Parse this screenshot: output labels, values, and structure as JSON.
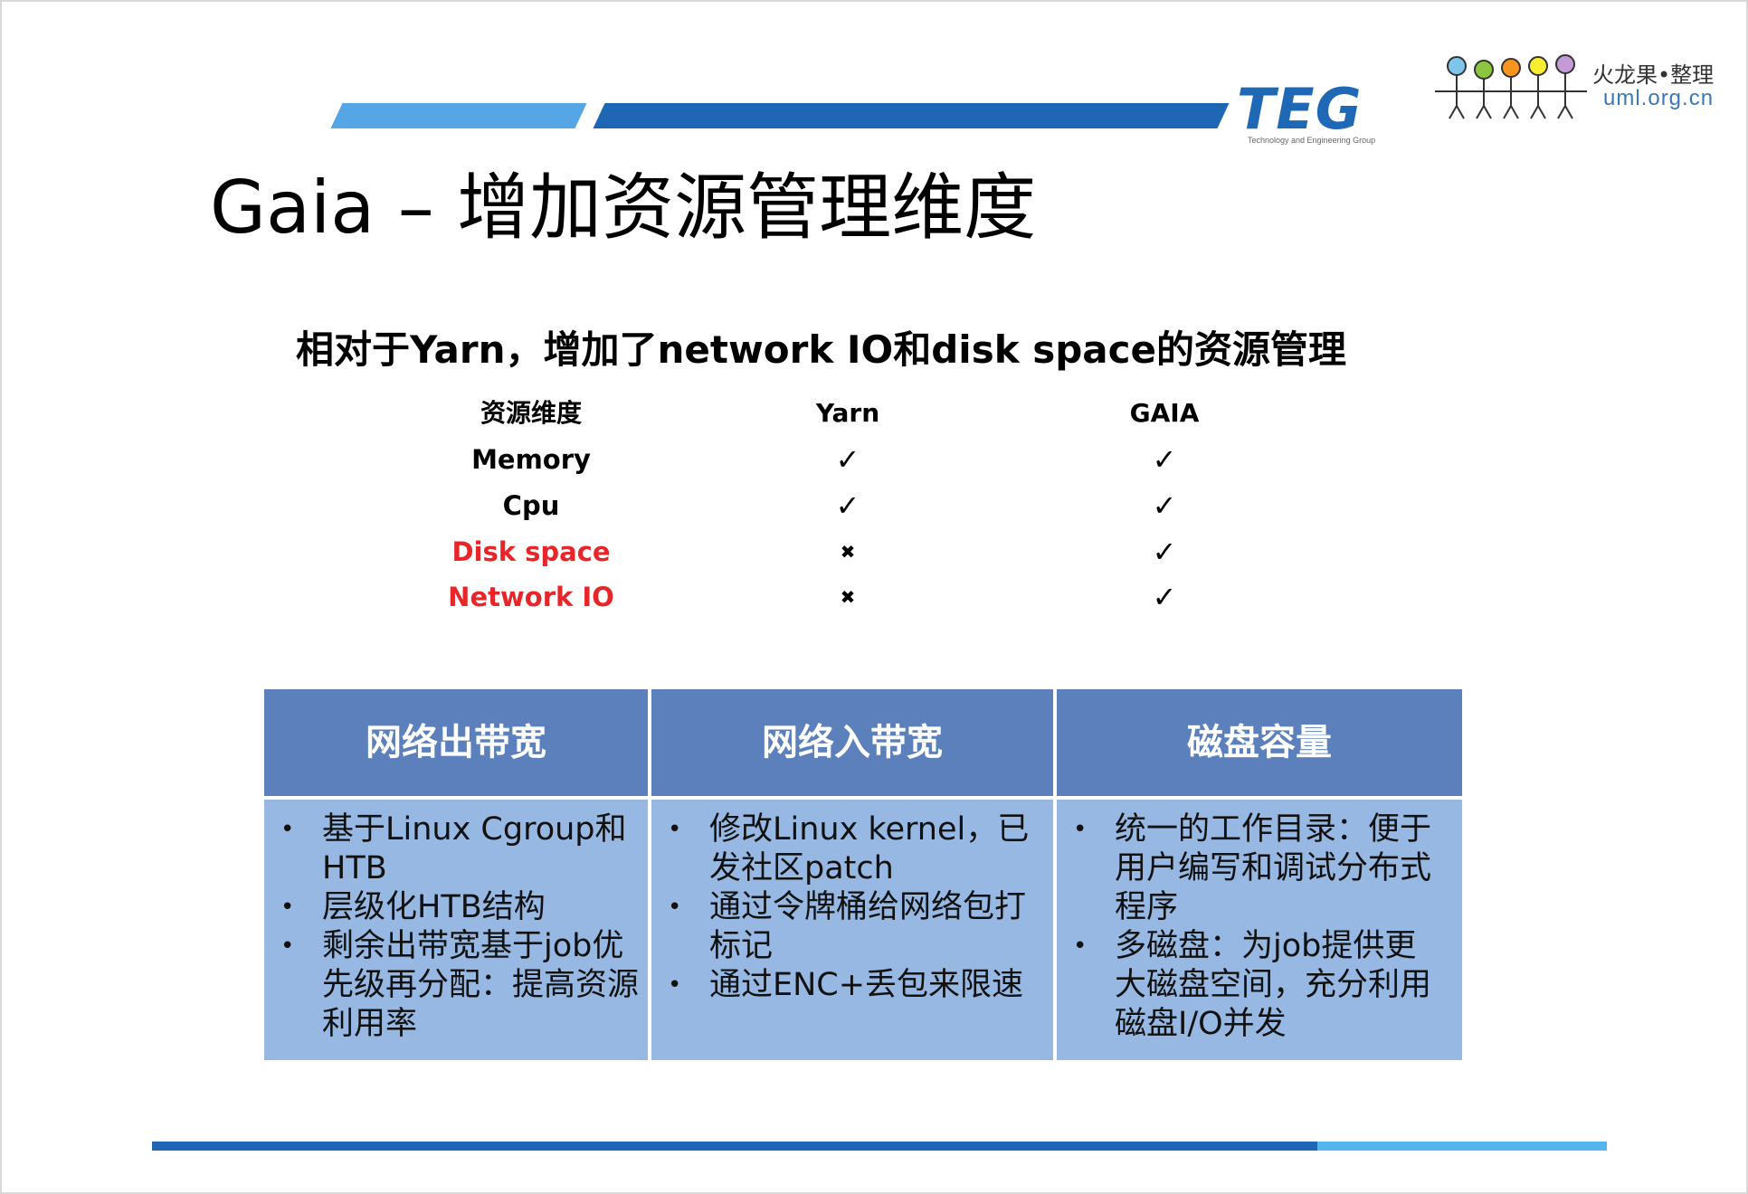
{
  "header": {
    "teg_logo_text": "TEG",
    "teg_logo_subtext": "Technology and Engineering Group",
    "watermark_top": "火龙果•整理",
    "watermark_bottom": "uml.org.cn"
  },
  "title": "Gaia – 增加资源管理维度",
  "subtitle": "相对于Yarn，增加了network IO和disk space的资源管理",
  "comparison": {
    "headers": [
      "资源维度",
      "Yarn",
      "GAIA"
    ],
    "rows": [
      {
        "name": "Memory",
        "yarn": "✓",
        "gaia": "✓",
        "highlight": false
      },
      {
        "name": "Cpu",
        "yarn": "✓",
        "gaia": "✓",
        "highlight": false
      },
      {
        "name": "Disk space",
        "yarn": "✖",
        "gaia": "✓",
        "highlight": true
      },
      {
        "name": "Network IO",
        "yarn": "✖",
        "gaia": "✓",
        "highlight": true
      }
    ],
    "highlight_color": "#e8262a"
  },
  "features": {
    "columns": [
      {
        "title": "网络出带宽",
        "items": [
          [
            "基于Linux Cgroup和",
            "HTB"
          ],
          [
            "层级化HTB结构"
          ],
          [
            "剩余出带宽基于job优",
            "先级再分配：提高资源",
            "利用率"
          ]
        ]
      },
      {
        "title": "网络入带宽",
        "items": [
          [
            "修改Linux kernel，已",
            "发社区patch"
          ],
          [
            "通过令牌桶给网络包打",
            "标记"
          ],
          [
            "通过ENC+丢包来限速"
          ]
        ]
      },
      {
        "title": "磁盘容量",
        "items": [
          [
            "统一的工作目录：便于",
            "用户编写和调试分布式",
            "程序"
          ],
          [
            "多磁盘：为job提供更",
            "大磁盘空间，充分利用",
            "磁盘I/O并发"
          ]
        ]
      }
    ],
    "bullet": "•",
    "header_color": "#5b80bb",
    "body_color": "#96b8e2"
  },
  "colors": {
    "stripe_light": "#55a6e6",
    "stripe_dark": "#1f67b5"
  }
}
